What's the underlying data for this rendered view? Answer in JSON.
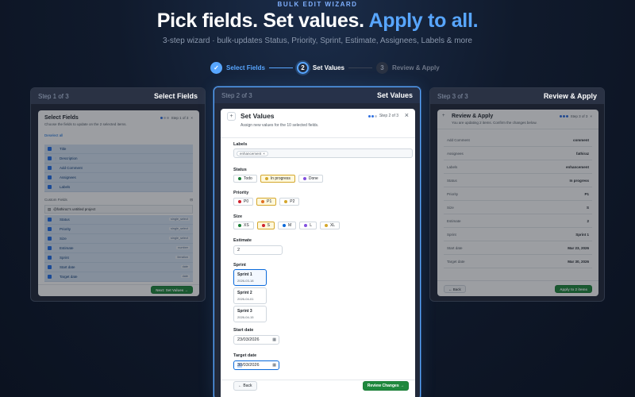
{
  "header": {
    "eyebrow": "BULK EDIT WIZARD",
    "title_main": "Pick fields. Set values.",
    "title_accent": "Apply to all.",
    "subtitle": "3-step wizard · bulk-updates Status, Priority, Sprint, Estimate, Assignees, Labels & more"
  },
  "stepper": [
    {
      "label": "Select Fields",
      "marker": "✓",
      "state": "done"
    },
    {
      "label": "Set Values",
      "marker": "2",
      "state": "current"
    },
    {
      "label": "Review & Apply",
      "marker": "3",
      "state": "todo"
    }
  ],
  "colors": {
    "accent": "#58a6ff",
    "primary_button": "#1f883d",
    "selected_chip": "#fff8dc"
  },
  "panel1": {
    "step": "Step 1 of 3",
    "title": "Select Fields",
    "card_title": "Select Fields",
    "card_desc": "Choose the fields to update on the 2 selected items.",
    "step_tag": "Step 1 of 3",
    "deselect": "Deselect all",
    "fields": [
      "Title",
      "Description",
      "Add Comment",
      "Assignees",
      "Labels"
    ],
    "custom_header": "Custom Fields",
    "project": "@fathiraz's untitled project",
    "custom_fields": [
      {
        "name": "Status",
        "type": "single_select"
      },
      {
        "name": "Priority",
        "type": "single_select"
      },
      {
        "name": "Size",
        "type": "single_select"
      },
      {
        "name": "Estimate",
        "type": "number"
      },
      {
        "name": "Sprint",
        "type": "iteration"
      },
      {
        "name": "Start date",
        "type": "date"
      },
      {
        "name": "Target date",
        "type": "date"
      }
    ],
    "next_button": "Next: Set Values →"
  },
  "panel2": {
    "step": "Step 2 of 3",
    "title": "Set Values",
    "card_title": "Set Values",
    "card_desc": "Assign new values for the 10 selected fields.",
    "step_tag": "Step 2 of 3",
    "labels_label": "Labels",
    "label_tag": "enhancement",
    "status_label": "Status",
    "status_options": [
      {
        "name": "Todo",
        "color": "#1a7f37",
        "selected": false
      },
      {
        "name": "In progress",
        "color": "#d4a72c",
        "selected": true
      },
      {
        "name": "Done",
        "color": "#8250df",
        "selected": false
      }
    ],
    "priority_label": "Priority",
    "priority_options": [
      {
        "name": "P0",
        "color": "#cf222e",
        "selected": false
      },
      {
        "name": "P1",
        "color": "#e16f24",
        "selected": true
      },
      {
        "name": "P2",
        "color": "#d4a72c",
        "selected": false
      }
    ],
    "size_label": "Size",
    "size_options": [
      {
        "name": "XS",
        "color": "#1a7f37",
        "selected": false
      },
      {
        "name": "S",
        "color": "#cf222e",
        "selected": true
      },
      {
        "name": "M",
        "color": "#0969da",
        "selected": false
      },
      {
        "name": "L",
        "color": "#8250df",
        "selected": false
      },
      {
        "name": "XL",
        "color": "#d4a72c",
        "selected": false
      }
    ],
    "estimate_label": "Estimate",
    "estimate_value": "2",
    "sprint_label": "Sprint",
    "sprints": [
      {
        "name": "Sprint 1",
        "date": "2026-03-18",
        "selected": true
      },
      {
        "name": "Sprint 2",
        "date": "2026-04-01",
        "selected": false
      },
      {
        "name": "Sprint 3",
        "date": "2026-04-15",
        "selected": false
      }
    ],
    "start_label": "Start date",
    "start_value": "23/03/2026",
    "target_label": "Target date",
    "target_value_hl": "30",
    "target_value_rest": "/03/2026",
    "back_button": "← Back",
    "review_button": "Review Changes →"
  },
  "panel3": {
    "step": "Step 3 of 3",
    "title": "Review & Apply",
    "card_title": "Review & Apply",
    "card_desc": "You are updating 2 items. Confirm the changes below.",
    "step_tag": "Step 3 of 3",
    "rows": [
      {
        "k": "Add Comment",
        "v": "comment"
      },
      {
        "k": "Assignees",
        "v": "fathiraz"
      },
      {
        "k": "Labels",
        "v": "enhancement"
      },
      {
        "k": "Status",
        "v": "In progress"
      },
      {
        "k": "Priority",
        "v": "P1"
      },
      {
        "k": "Size",
        "v": "S"
      },
      {
        "k": "Estimate",
        "v": "2"
      },
      {
        "k": "Sprint",
        "v": "Sprint 1"
      },
      {
        "k": "Start date",
        "v": "Mar 23, 2026"
      },
      {
        "k": "Target date",
        "v": "Mar 30, 2026"
      }
    ],
    "back_button": "← Back",
    "apply_button": "Apply to 2 items"
  }
}
